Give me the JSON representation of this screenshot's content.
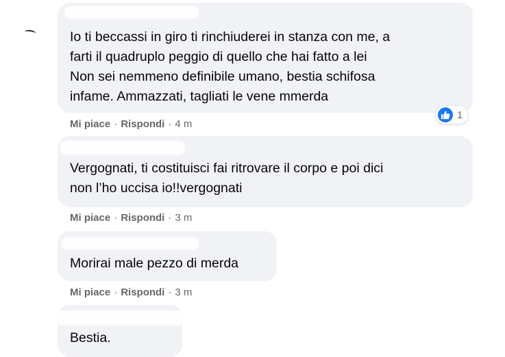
{
  "comments": [
    {
      "text": "Io ti beccassi in giro ti rinchiuderei in stanza con me, a\nfarti il quadruplo peggio di quello che hai fatto a lei\nNon sei nemmeno definibile umano, bestia schifosa\ninfame. Ammazzati, tagliati le vene mmerda",
      "like_label": "Mi piace",
      "reply_label": "Rispondi",
      "time": "4 m",
      "reaction_count": "1"
    },
    {
      "text": "Vergognati, ti costituisci fai ritrovare il corpo e poi dici\nnon l’ho uccisa io!!vergognati",
      "like_label": "Mi piace",
      "reply_label": "Rispondi",
      "time": "3 m"
    },
    {
      "text": "Morirai male pezzo di merda",
      "like_label": "Mi piace",
      "reply_label": "Rispondi",
      "time": "3 m"
    },
    {
      "text": "Bestia."
    }
  ],
  "colors": {
    "bubble": "#f0f2f5",
    "meta_text": "#65676b",
    "like_blue": "#1877f2"
  },
  "icons": {
    "reaction": "like-thumbs-up-icon"
  }
}
